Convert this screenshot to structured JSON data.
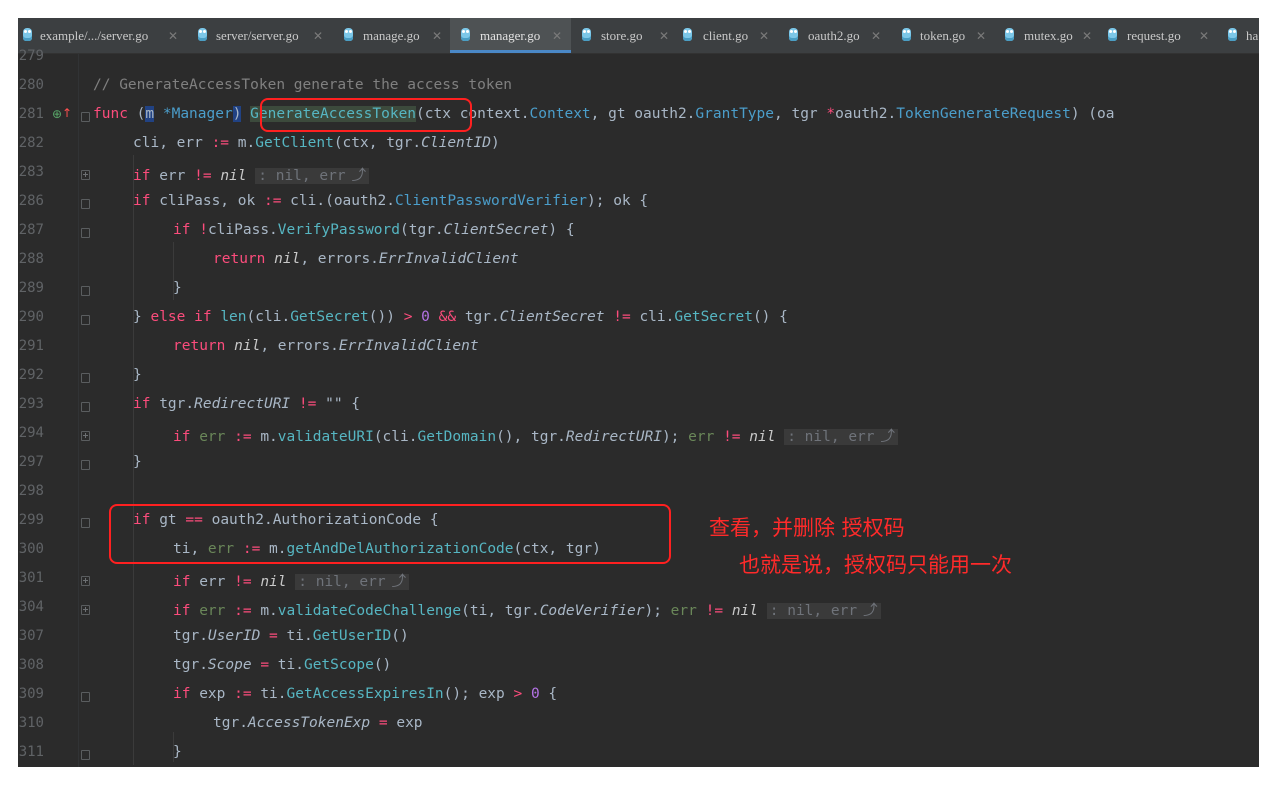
{
  "tabs": [
    {
      "label": "example/.../server.go",
      "active": false
    },
    {
      "label": "server/server.go",
      "active": false
    },
    {
      "label": "manage.go",
      "active": false
    },
    {
      "label": "manager.go",
      "active": true
    },
    {
      "label": "store.go",
      "active": false
    },
    {
      "label": "client.go",
      "active": false
    },
    {
      "label": "oauth2.go",
      "active": false
    },
    {
      "label": "token.go",
      "active": false
    },
    {
      "label": "mutex.go",
      "active": false
    },
    {
      "label": "request.go",
      "active": false
    },
    {
      "label": "ha",
      "active": false
    }
  ],
  "line_numbers": [
    "279",
    "280",
    "281",
    "282",
    "283",
    "286",
    "287",
    "288",
    "289",
    "290",
    "291",
    "292",
    "293",
    "294",
    "297",
    "298",
    "299",
    "300",
    "301",
    "304",
    "307",
    "308",
    "309",
    "310",
    "311"
  ],
  "code": {
    "l280": "// GenerateAccessToken generate the access token",
    "l281_func": "func",
    "l281_recv": "m",
    "l281_recvtype": "*Manager",
    "l281_name": "GenerateAccessToken",
    "l281_rest1": "(ctx context.",
    "l281_ctxtype": "Context",
    "l281_rest2": ", gt oauth2.",
    "l281_gttype": "GrantType",
    "l281_rest3": ", tgr ",
    "l281_star": "*",
    "l281_rest4": "oauth2.",
    "l281_tgrtype": "TokenGenerateRequest",
    "l281_rest5": ") (oa",
    "l282_a": "cli, err ",
    "l282_op": ":=",
    "l282_b": " m.",
    "l282_fn": "GetClient",
    "l282_c": "(ctx, tgr.",
    "l282_field": "ClientID",
    "l282_d": ")",
    "hint_nil_err": ": nil, err",
    "l286_a": " cliPass, ok ",
    "l286_b": " cli.(oauth2.",
    "l286_type": "ClientPasswordVerifier",
    "l286_c": "); ok {",
    "l287_a": "cliPass.",
    "l287_fn": "VerifyPassword",
    "l287_b": "(tgr.",
    "l287_field": "ClientSecret",
    "l287_c": ") {",
    "return": "return",
    "nil": "nil",
    "errors_prefix": "errors.",
    "err_invalid_client": "ErrInvalidClient",
    "close_brace": "}",
    "l290_a": "} ",
    "l290_else": "else",
    "l290_if": "if",
    "l290_len": "len",
    "l290_b": "(cli.",
    "l290_fn": "GetSecret",
    "l290_c": "()) ",
    "l290_gt": ">",
    "l290_zero": "0",
    "l290_and": "&&",
    "l290_d": " tgr.",
    "l290_field": "ClientSecret",
    "l290_ne": "!=",
    "l290_e": " cli.",
    "l290_fn2": "GetSecret",
    "l290_f": "() {",
    "l293_a": " tgr.",
    "l293_field": "RedirectURI",
    "l293_str": "\"\"",
    "l293_b": " {",
    "l294_err": " err ",
    "l294_a": " m.",
    "l294_fn": "validateURI",
    "l294_b": "(cli.",
    "l294_fn2": "GetDomain",
    "l294_c": "(), tgr.",
    "l294_field": "RedirectURI",
    "l294_d": "); ",
    "l294_err2": "err",
    "l299_a": " gt ",
    "l299_eq": "==",
    "l299_b": " oauth2.AuthorizationCode {",
    "l300_a": "ti, ",
    "l300_err": "err",
    "l300_b": " m.",
    "l300_fn": "getAndDelAuthorizationCode",
    "l300_c": "(ctx, tgr)",
    "l301_err": " err ",
    "l304_a": " m.",
    "l304_fn": "validateCodeChallenge",
    "l304_b": "(ti, tgr.",
    "l304_field": "CodeVerifier",
    "l304_c": "); ",
    "l307_a": "tgr.",
    "l307_field": "UserID",
    "l307_eq": "=",
    "l307_b": " ti.",
    "l307_fn": "GetUserID",
    "l307_c": "()",
    "l308_field": "Scope",
    "l308_fn": "GetScope",
    "l309_a": " exp ",
    "l309_b": " ti.",
    "l309_fn": "GetAccessExpiresIn",
    "l309_c": "(); exp ",
    "l309_d": " {",
    "l310_field": "AccessTokenExp",
    "l310_b": " exp",
    "if": "if",
    "assign": ":=",
    "not": "!",
    "ne": "!=",
    "err": " err ",
    "tgr_prefix": "tgr."
  },
  "annotations": {
    "line1": "查看，并删除 授权码",
    "line2": "也就是说，授权码只能用一次"
  },
  "colors": {
    "background": "#2b2b2b",
    "keyword": "#fc4c7c",
    "function": "#56b6c2",
    "annotation": "#ff2a2a"
  }
}
